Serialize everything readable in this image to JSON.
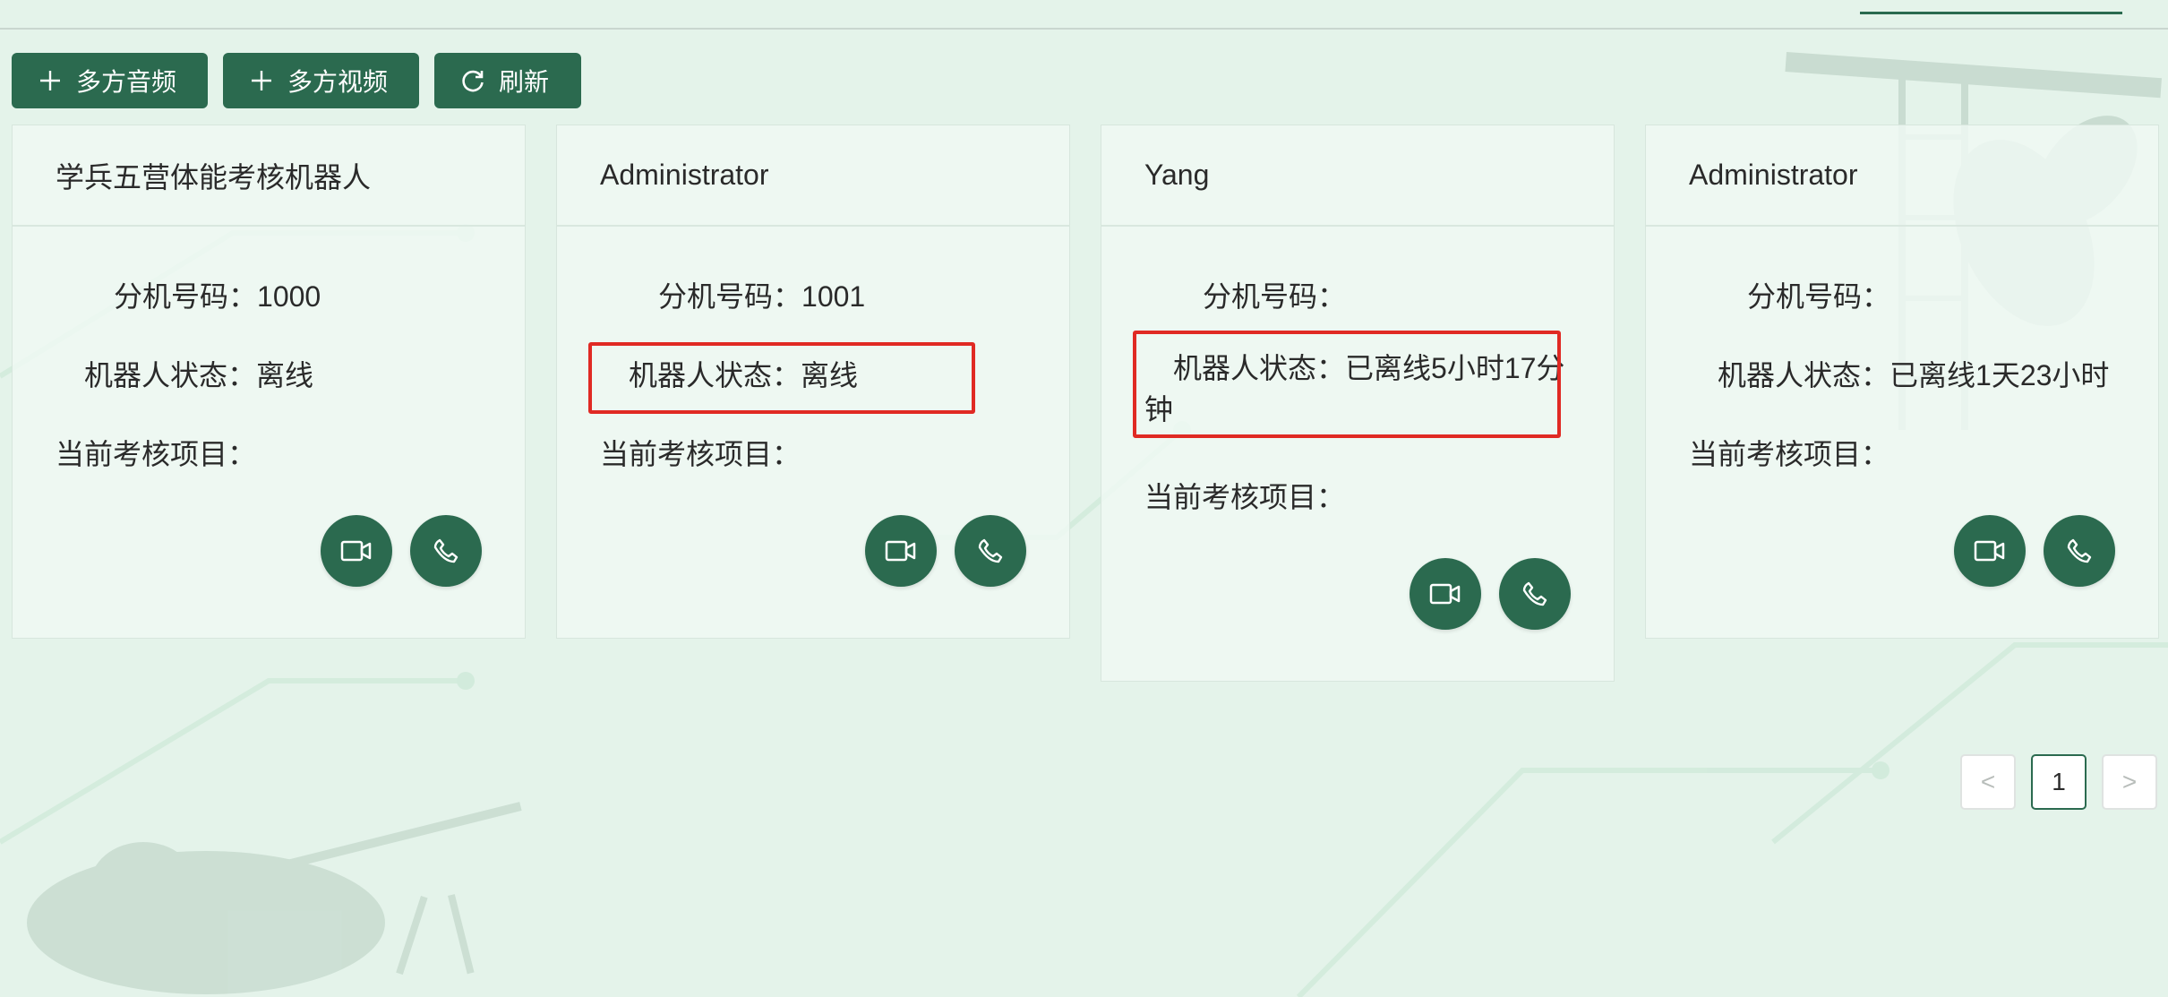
{
  "toolbar": {
    "multi_audio_label": "多方音频",
    "multi_video_label": "多方视频",
    "refresh_label": "刷新"
  },
  "labels": {
    "extension": "分机号码：",
    "robot_status": "机器人状态：",
    "current_item": "当前考核项目："
  },
  "cards": [
    {
      "title": "学兵五营体能考核机器人",
      "extension": "1000",
      "status": "离线",
      "current_item": ""
    },
    {
      "title": "Administrator",
      "extension": "1001",
      "status": "离线",
      "current_item": ""
    },
    {
      "title": "Yang",
      "extension": "",
      "status": "已离线5小时17分钟",
      "current_item": ""
    },
    {
      "title": "Administrator",
      "extension": "",
      "status": "已离线1天23小时",
      "current_item": ""
    }
  ],
  "pagination": {
    "prev": "<",
    "current_page": "1",
    "next": ">"
  },
  "colors": {
    "brand_green": "#2b6a4f",
    "background": "#e4f3ea",
    "highlight_red": "#e02a24"
  },
  "icons": [
    "plus-icon",
    "refresh-icon",
    "video-camera-icon",
    "phone-icon"
  ]
}
